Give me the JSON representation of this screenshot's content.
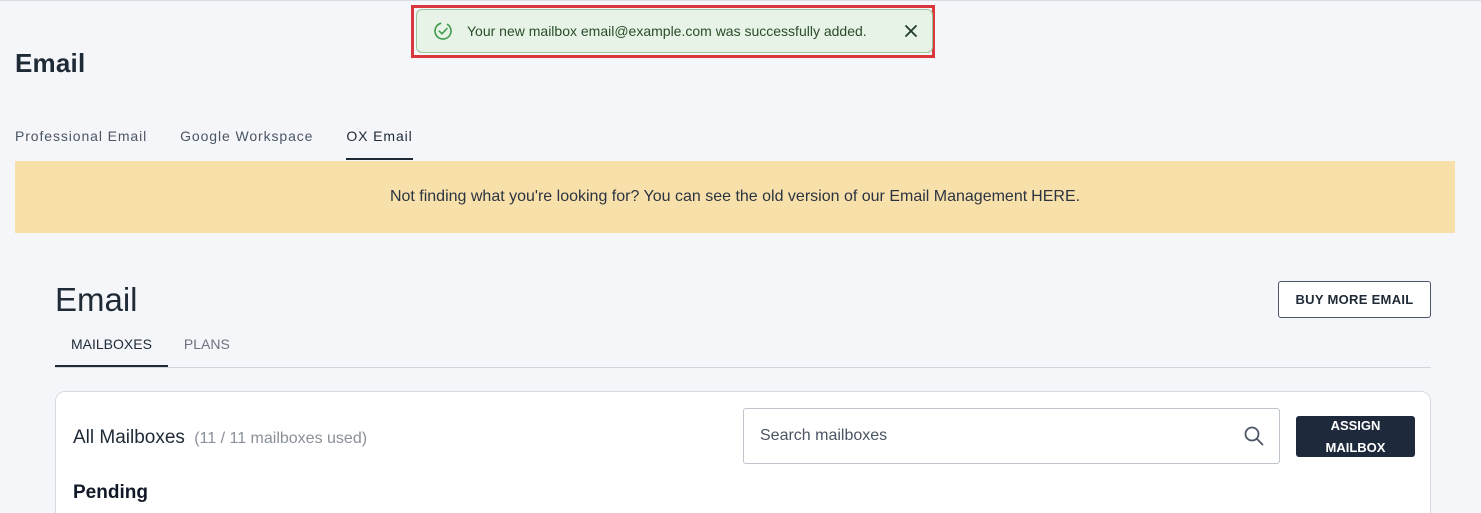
{
  "toast": {
    "message": "Your new mailbox email@example.com was successfully added.",
    "icon": "check-circle-icon",
    "close_icon": "close-icon"
  },
  "page": {
    "title": "Email"
  },
  "top_tabs": [
    {
      "label": "Professional Email",
      "active": false
    },
    {
      "label": "Google Workspace",
      "active": false
    },
    {
      "label": "OX Email",
      "active": true
    }
  ],
  "banner": {
    "text": "Not finding what you're looking for? You can see the old version of our Email Management",
    "link": "HERE."
  },
  "section": {
    "title": "Email",
    "buy_button": "BUY MORE EMAIL",
    "tabs": [
      {
        "label": "MAILBOXES",
        "active": true
      },
      {
        "label": "PLANS",
        "active": false
      }
    ]
  },
  "card": {
    "title": "All Mailboxes",
    "count": "(11 / 11 mailboxes used)",
    "search_placeholder": "Search mailboxes",
    "assign_button": "ASSIGN MAILBOX",
    "pending_label": "Pending"
  },
  "colors": {
    "toast_bg": "#e7f3e6",
    "toast_border_highlight": "#d9363e",
    "banner_bg": "#f8e0ab",
    "primary_button": "#1e2a3b"
  }
}
